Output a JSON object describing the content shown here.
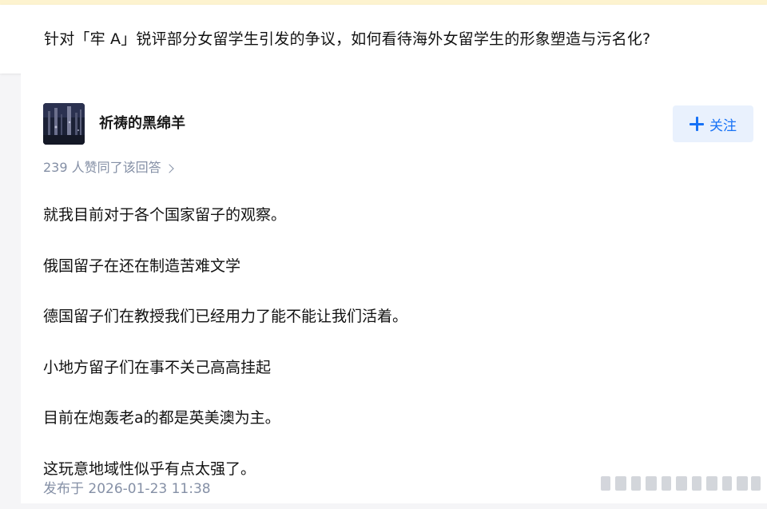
{
  "question": {
    "title": "针对「牢 A」锐评部分女留学生引发的争议，如何看待海外女留学生的形象塑造与污名化?"
  },
  "answer": {
    "author": {
      "name": "祈祷的黑绵羊",
      "avatar_icon": "avatar-image"
    },
    "follow_button": {
      "label": "关注",
      "icon": "plus-icon"
    },
    "vote_summary": "239 人赞同了该回答",
    "paragraphs": [
      "就我目前对于各个国家留子的观察。",
      "俄国留子在还在制造苦难文学",
      "德国留子们在教授我们已经用力了能不能让我们活着。",
      "小地方留子们在事不关己高高挂起",
      "目前在炮轰老a的都是英美澳为主。",
      "这玩意地域性似乎有点太强了。"
    ],
    "publish_time": "发布于 2026-01-23 11:38"
  },
  "colors": {
    "accent": "#1772f6",
    "muted_text": "#8590a6",
    "follow_bg": "#e9f1fd",
    "top_strip": "#fdf3cf"
  }
}
